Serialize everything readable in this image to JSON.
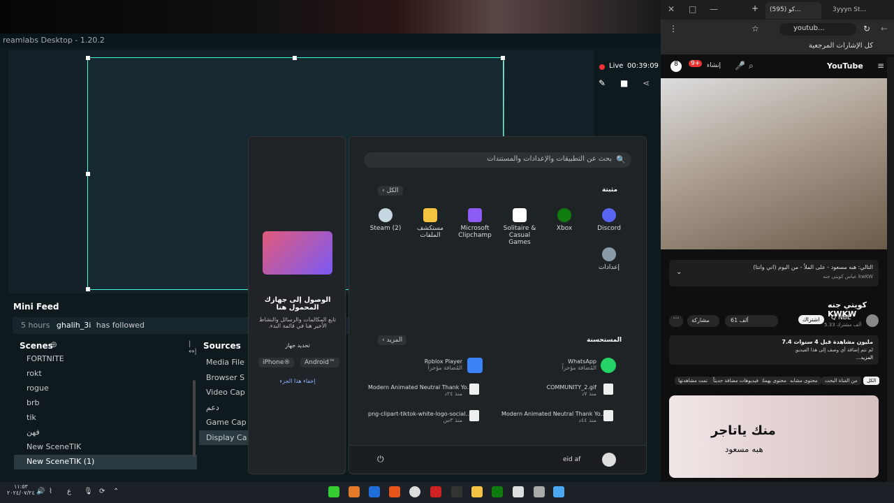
{
  "streamlabs": {
    "title": "reamlabs Desktop - 1.20.2",
    "live_label": "Live",
    "live_time": "00:39:09",
    "mini_feed_title": "Mini Feed",
    "feed_time": "5 hours",
    "feed_user": "ghalih_3i",
    "feed_action": "has followed",
    "scenes_title": "Scenes",
    "sources_title": "Sources",
    "scenes": [
      "FORTNITE",
      "rokt",
      "rogue",
      "brb",
      "tik",
      "فهن",
      "New SceneTIK",
      "New SceneTIK (1)"
    ],
    "sources": [
      "Media File",
      "Browser S",
      "Video Cap",
      "دعم",
      "Game Cap",
      "Display Ca"
    ]
  },
  "start_menu": {
    "search_placeholder": "بحث عن التطبيقات والإعدادات والمستندات",
    "pinned_title": "مثبتة",
    "all_button": "الكل",
    "pinned": [
      {
        "label": "Discord",
        "icon": "discord-icon",
        "color": "#5865f2"
      },
      {
        "label": "Xbox",
        "icon": "xbox-icon",
        "color": "#107c10"
      },
      {
        "label": "Solitaire & Casual Games",
        "icon": "cards-icon",
        "color": "#ffffff"
      },
      {
        "label": "Microsoft Clipchamp",
        "icon": "clipchamp-icon",
        "color": "#8c5cf5"
      },
      {
        "label": "مستكشف الملفات",
        "icon": "folder-icon",
        "color": "#f5c342"
      },
      {
        "label": "Steam (2)",
        "icon": "steam-icon",
        "color": "#c7d5e0"
      },
      {
        "label": "إعدادات",
        "icon": "gear-icon",
        "color": "#8a9aa8"
      }
    ],
    "recommended_title": "المستحسنة",
    "more_button": "المزيد",
    "recommended": [
      {
        "title": "WhatsApp",
        "sub": "المُضافة مؤخراً",
        "icon": "whatsapp-icon"
      },
      {
        "title": "Roblox Player",
        "sub": "المُضافة مؤخراً",
        "icon": "roblox-icon"
      },
      {
        "title": "COMMUNITY_2.gif",
        "sub": "منذ ٧د",
        "icon": "image-file-icon"
      },
      {
        "title": "Modern Animated Neutral Thank Yo...",
        "sub": "منذ ٢٤د",
        "icon": "video-file-icon"
      },
      {
        "title": "Modern Animated Neutral Thank Yo...",
        "sub": "منذ ٤٤د",
        "icon": "video-file-icon"
      },
      {
        "title": "png-clipart-tiktok-white-logo-social...",
        "sub": "منذ ٣س",
        "icon": "image-file-icon"
      }
    ],
    "user_name": "eid af",
    "phone_panel": {
      "title": "الوصول إلى جهازك المحمول هنا",
      "desc": "تابع المكالمات والرسائل والنشاط الأخير هنا في قائمة البدء.",
      "choose": "تحديد جهاز",
      "iphone": "iPhone®",
      "android": "Android™",
      "hide": "إخفاء هذا الجزء"
    }
  },
  "browser": {
    "tab1": "(595) كو...",
    "tab2": "3yyyn St...",
    "address": "youtub...",
    "bookmarks_label": "كل الإشارات المرجعية",
    "yt_brand": "YouTube",
    "yt_create": "إنشاء",
    "notif_count": "9+",
    "playlist_title": "التالي: هبه مسعود - على الملأ - من اليوم (اني وانتا)",
    "playlist_sub": "عباس كويتي جنه kwKW",
    "video_title": "كويتي جنه KWKW",
    "channel": "Q NBE",
    "subs": "5.33 ألف مشترك",
    "subscribe": "اشتراك",
    "likes": "61 ألف",
    "share": "مشاركة",
    "views_line": "7.4 مليون مشاهدة قبل 4 سنوات",
    "desc_line": "لم تتم إضافة أي وصف إلى هذا الفيديو.",
    "more": "...المزيد",
    "chips": [
      "الكل",
      "من القناة البحث",
      "محتوى مشابه",
      "محتوى يهمك",
      "فيديوهات مضافة حديثاً",
      "تمت مشاهدتها"
    ],
    "thumb_text1": "منك ياتاجر",
    "thumb_text2": "هبه مسعود"
  },
  "taskbar": {
    "time": "١١:٥٣",
    "date": "٢٠٢٤/٠٧/٢٤",
    "lang": "ع"
  }
}
